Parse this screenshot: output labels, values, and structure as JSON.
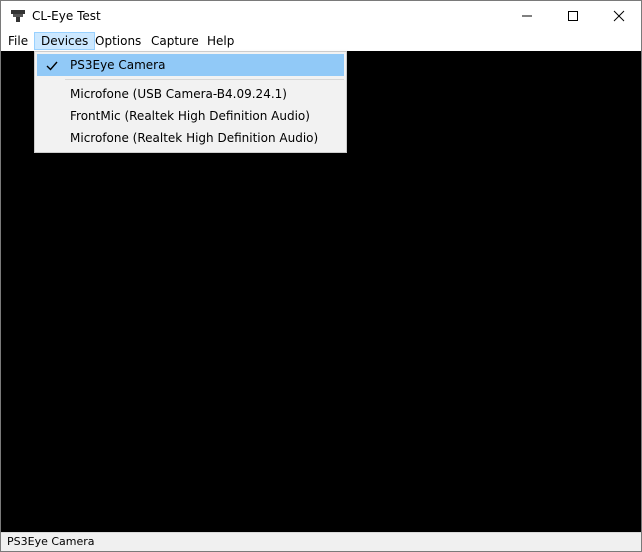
{
  "window": {
    "title": "CL-Eye Test"
  },
  "menubar": {
    "items": [
      "File",
      "Devices",
      "Options",
      "Capture",
      "Help"
    ]
  },
  "devices_menu": {
    "checked_item": "PS3Eye Camera",
    "items": [
      "Microfone (USB Camera-B4.09.24.1)",
      "FrontMic (Realtek High Definition Audio)",
      "Microfone (Realtek High Definition Audio)"
    ]
  },
  "statusbar": {
    "text": "PS3Eye Camera"
  },
  "colors": {
    "menu_hover": "#cce8ff",
    "checked_highlight": "#91c9f7",
    "video_bg": "#000000"
  }
}
